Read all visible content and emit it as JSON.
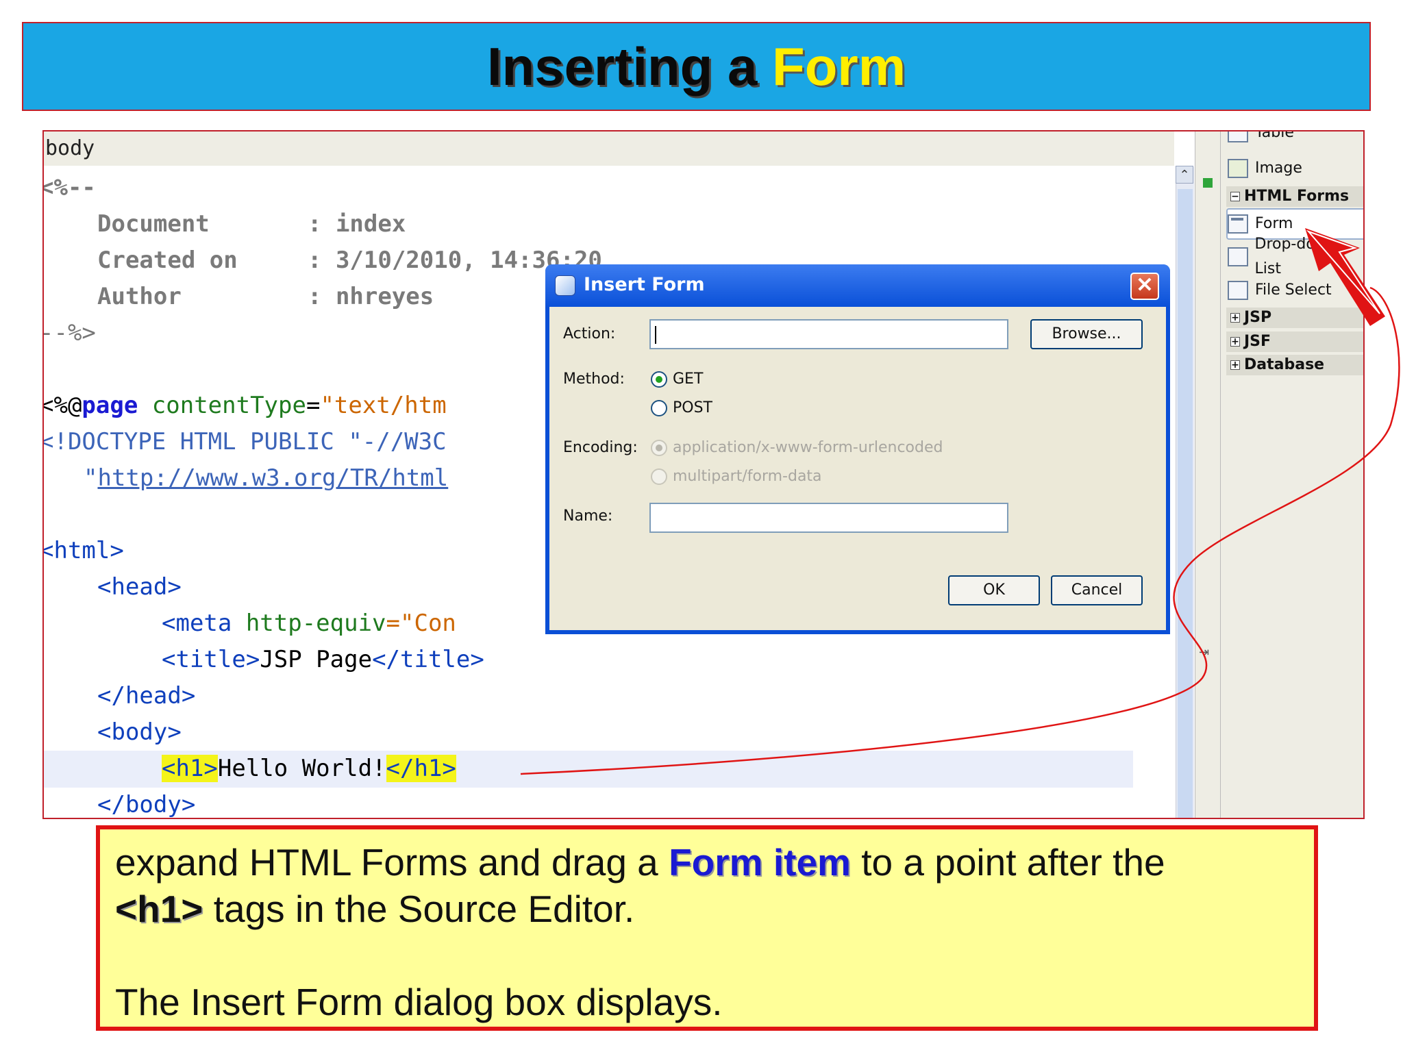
{
  "slide": {
    "title_part1": "Inserting a ",
    "title_part2": "Form"
  },
  "editor": {
    "breadcrumb": "body",
    "lines": {
      "l1": "<%--",
      "l2_k": "Document",
      "l2_v": ": index",
      "l3_k": "Created on",
      "l3_v": ": 3/10/2010, 14:36:20",
      "l4_k": "Author",
      "l4_v": ": nhreyes",
      "l5": "--%>",
      "l6_a": "<%@",
      "l6_b": "page",
      "l6_c": " contentType",
      "l6_d": "=",
      "l6_e": "\"text/htm",
      "l7": "<!DOCTYPE HTML PUBLIC \"-//W3C",
      "l8_q": "\"",
      "l8_url": "http://www.w3.org/TR/html",
      "l9": "<html>",
      "l10": "<head>",
      "l11_a": "<meta",
      "l11_b": " http-equiv",
      "l11_c": "=\"Con",
      "l12_a": "<title>",
      "l12_b": "JSP Page",
      "l12_c": "</title>",
      "l13": "</head>",
      "l14": "<body>",
      "l15_a": "<h1>",
      "l15_b": "Hello World!",
      "l15_c": "</h1>",
      "l16": "</body>"
    }
  },
  "palette": {
    "table": "Table",
    "image": "Image",
    "html_forms": "HTML Forms",
    "form": "Form",
    "dropdown": "Drop-down List",
    "file_select": "File Select",
    "jsp": "JSP",
    "jsf": "JSF",
    "database": "Database"
  },
  "dialog": {
    "title": "Insert Form",
    "action_label": "Action:",
    "action_value": "",
    "browse_button": "Browse...",
    "method_label": "Method:",
    "method_get": "GET",
    "method_post": "POST",
    "encoding_label": "Encoding:",
    "encoding_urlencoded": "application/x-www-form-urlencoded",
    "encoding_multipart": "multipart/form-data",
    "name_label": "Name:",
    "name_value": "",
    "ok_button": "OK",
    "cancel_button": "Cancel"
  },
  "instruction": {
    "p1_a": "expand HTML Forms and drag a ",
    "p1_b": "Form item",
    "p1_c": " to a point after the",
    "p1_d": "<h1>",
    "p1_e": " tags in the Source Editor.",
    "p2": "The Insert Form dialog box displays."
  },
  "colors": {
    "banner": "#1aa6e4",
    "title_highlight": "#ffee00",
    "frame_red": "#c0202a",
    "instruction_bg": "#ffff99",
    "dialog_blue": "#0a4fd6"
  }
}
